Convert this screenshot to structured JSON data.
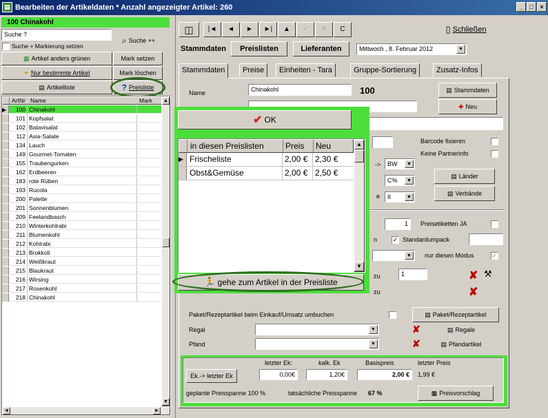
{
  "window": {
    "title": "Bearbeiten der Artikeldaten * Anzahl angezeigter Artikel: 260",
    "buttons": [
      "_",
      "□",
      "×"
    ]
  },
  "left": {
    "current_article": "100 Chinakohl",
    "search_value": "Suche ?",
    "search_button": "Suche ++",
    "search_mark_label": "Suche + Markierung setzen",
    "btn_other_green": "Artikel anders grünen",
    "btn_mark_set": "Mark setzen",
    "btn_only_certain": "Nur bestimmte Artikel",
    "btn_mark_delete": "Mark löschen",
    "btn_article_list": "Artikelliste",
    "btn_price_list": "Preisliste",
    "col_nr": "ArtNr",
    "col_name": "Name",
    "col_mark": "Mark",
    "rows": [
      {
        "nr": "100",
        "name": "Chinakohl"
      },
      {
        "nr": "101",
        "name": "Kopfsalat"
      },
      {
        "nr": "102",
        "name": "Batavisalat"
      },
      {
        "nr": "112",
        "name": "Asia-Salate"
      },
      {
        "nr": "134",
        "name": "Lauch"
      },
      {
        "nr": "149",
        "name": "Gourmet-Tomaten"
      },
      {
        "nr": "155",
        "name": "Traubengurken"
      },
      {
        "nr": "162",
        "name": "Erdbeeren"
      },
      {
        "nr": "183",
        "name": "rote Rüben"
      },
      {
        "nr": "193",
        "name": "Rucola"
      },
      {
        "nr": "200",
        "name": "Palette"
      },
      {
        "nr": "201",
        "name": "Sonnenblumen"
      },
      {
        "nr": "209",
        "name": "Feelandbasch"
      },
      {
        "nr": "210",
        "name": "Winterkohlrabi"
      },
      {
        "nr": "211",
        "name": "Blumenkohl"
      },
      {
        "nr": "212",
        "name": "Kohlrabi"
      },
      {
        "nr": "213",
        "name": "Brokkoli"
      },
      {
        "nr": "214",
        "name": "Weißkraut"
      },
      {
        "nr": "215",
        "name": "Blaukraut"
      },
      {
        "nr": "216",
        "name": "Wirsing"
      },
      {
        "nr": "217",
        "name": "Rosenkohl"
      },
      {
        "nr": "218",
        "name": "Chinakohl"
      }
    ]
  },
  "toolbar": {
    "nav": [
      "|◄",
      "◄",
      "►",
      "►|",
      "▲",
      "✓",
      "✕",
      "C"
    ],
    "close_label": "Schließen"
  },
  "subtabs": [
    "Stammdaten",
    "Preislisten",
    "Lieferanten"
  ],
  "date": "Mittwoch , 8. Februar 2012",
  "tabs": [
    "Stammdaten",
    "Preise",
    "Einheiten - Tara",
    "Gruppe-Sortierung",
    "Zusatz-Infos"
  ],
  "form": {
    "name_label": "Name",
    "name_value": "Chinakohl",
    "article_nr": "100",
    "btn_stammdaten": "Stammdaten",
    "btn_new": "Neu",
    "barcode_label": "Barcode fixieren",
    "partner_label": "Keine Partnerinfo",
    "bw_value": "BW",
    "c_value": "C%",
    "ii_value": "II",
    "btn_land": "Länder",
    "btn_verband": "Verbände",
    "one_value": "1",
    "price_labels_label": "Preisetiketten JA",
    "standard_pack_label": "Standardumpack",
    "only_mode_label": "nur diesen Modus",
    "zu1": "zu",
    "zu2": "zu",
    "zu_value": "1",
    "paket_label": "Paket/Rezeptartikel beim Einkauf/Umsatz umbuchen",
    "btn_paket": "Paket/Rezeptartikel",
    "regal_label": "Regal",
    "btn_regale": "Regale",
    "pfand_label": "Pfand",
    "btn_pfand": "Pfandartikel",
    "last_ek_label": "letzter Ek:",
    "calc_ek_label": "kalk. Ek",
    "base_price_label": "Basispreis",
    "last_price_label": "letzter Preis",
    "btn_ek": "Ek.-> letzter Ek",
    "last_ek_value": "0,00€",
    "calc_ek_value": "1,20€",
    "base_price_value": "2,00 €",
    "last_price_value": "1,99 €",
    "planned_margin": "geplante Preisspanne 100 %",
    "actual_margin_label": "tatsächliche Preisspanne",
    "actual_margin_value": "67 %",
    "btn_price_suggest": "Preisvorschlag"
  },
  "popup": {
    "ok_label": "OK",
    "col_list": "in diesen Preislisten",
    "col_price": "Preis",
    "col_new": "Neu",
    "rows": [
      {
        "name": "Frischeliste",
        "price": "2,00 €",
        "new": "2,30 €"
      },
      {
        "name": "Obst&Gemüse",
        "price": "2,00 €",
        "new": "2,50 €"
      }
    ],
    "goto_label": "gehe zum Artikel in der Preisliste"
  },
  "colors": {
    "green": "#4cde3c",
    "title_blue": "#0a246a",
    "red_x": "#c00000",
    "ellipse": "#2e6e1e"
  }
}
